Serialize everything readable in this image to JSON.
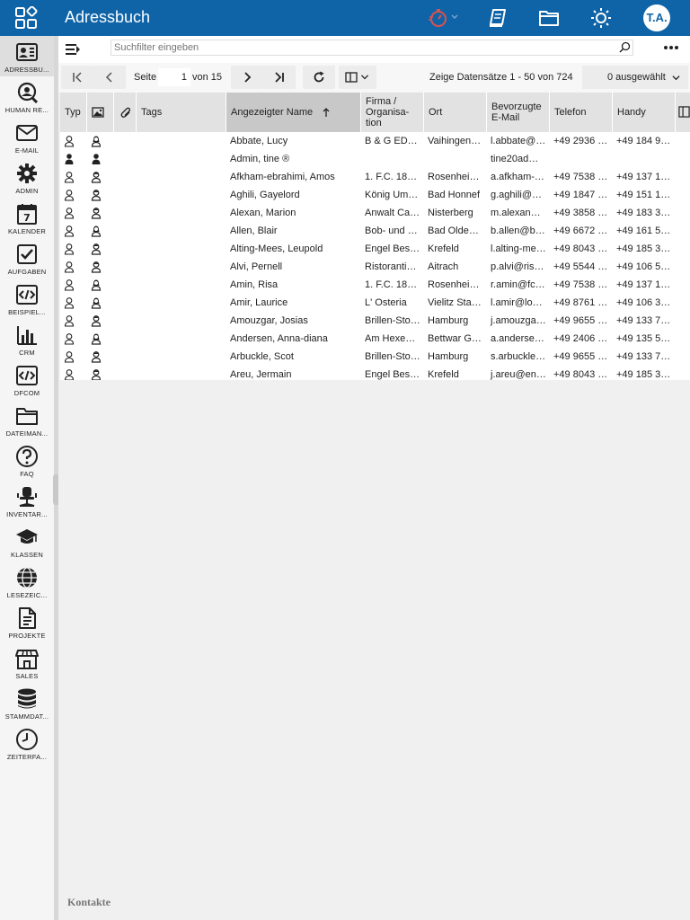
{
  "app": {
    "title": "Adressbuch",
    "user_initials": "T.A."
  },
  "colors": {
    "brand": "#0f64a8",
    "sidebar_bg": "#f5f5f5",
    "header_bg": "#e2e2e2",
    "timer_icon": "#d9534f"
  },
  "sidebar": {
    "items": [
      {
        "label": "ADRESSBU...",
        "icon": "contact-card-icon"
      },
      {
        "label": "HUMAN RE...",
        "icon": "user-search-icon"
      },
      {
        "label": "E-MAIL",
        "icon": "envelope-icon"
      },
      {
        "label": "ADMIN",
        "icon": "gear-icon"
      },
      {
        "label": "KALENDER",
        "icon": "calendar-icon"
      },
      {
        "label": "AUFGABEN",
        "icon": "checkbox-icon"
      },
      {
        "label": "BEISPIEL...",
        "icon": "code-icon"
      },
      {
        "label": "CRM",
        "icon": "bar-chart-icon"
      },
      {
        "label": "DFCOM",
        "icon": "code-icon"
      },
      {
        "label": "DATEIMAN...",
        "icon": "folder-icon"
      },
      {
        "label": "FAQ",
        "icon": "question-icon"
      },
      {
        "label": "INVENTAR...",
        "icon": "office-chair-icon"
      },
      {
        "label": "KLASSEN",
        "icon": "graduation-cap-icon"
      },
      {
        "label": "LESEZEIC...",
        "icon": "globe-icon"
      },
      {
        "label": "PROJEKTE",
        "icon": "document-icon"
      },
      {
        "label": "SALES",
        "icon": "store-icon"
      },
      {
        "label": "STAMMDAT...",
        "icon": "database-icon"
      },
      {
        "label": "ZEITERFA...",
        "icon": "clock-icon"
      }
    ]
  },
  "filter": {
    "placeholder": "Suchfilter eingeben"
  },
  "pager": {
    "page_label": "Seite",
    "current_page": "1",
    "of_label": "von 15",
    "records_text": "Zeige Datensätze 1 - 50 von 724",
    "selected_text": "0 ausgewählt"
  },
  "columns": [
    "Typ",
    "",
    "",
    "Tags",
    "Angezeigter Name",
    "Firma / Organisa-tion",
    "Ort",
    "Bevorzugte E-Mail",
    "Telefon",
    "Handy"
  ],
  "rows": [
    {
      "name": "Abbate, Lucy",
      "company": "B & G ED…",
      "city": "Vaihingen…",
      "email": "l.abbate@…",
      "phone": "+49 2936 …",
      "mobile": "+49 184 9…",
      "type": "outline",
      "gender": "female"
    },
    {
      "name": "Admin, tine ®",
      "company": "",
      "city": "",
      "email": "tine20ad…",
      "phone": "",
      "mobile": "",
      "type": "filled",
      "gender": "filled"
    },
    {
      "name": "Afkham-ebrahimi, Amos",
      "company": "1. F.C. 18…",
      "city": "Rosenhei…",
      "email": "a.afkham-…",
      "phone": "+49 7538 …",
      "mobile": "+49 137 1…",
      "type": "outline",
      "gender": "male"
    },
    {
      "name": "Aghili, Gayelord",
      "company": "König Um…",
      "city": "Bad Honnef",
      "email": "g.aghili@…",
      "phone": "+49 1847 …",
      "mobile": "+49 151 1…",
      "type": "outline",
      "gender": "male"
    },
    {
      "name": "Alexan, Marion",
      "company": "Anwalt Ca…",
      "city": "Nisterberg",
      "email": "m.alexan…",
      "phone": "+49 3858 …",
      "mobile": "+49 183 3…",
      "type": "outline",
      "gender": "male"
    },
    {
      "name": "Allen, Blair",
      "company": "Bob- und …",
      "city": "Bad Olde…",
      "email": "b.allen@b…",
      "phone": "+49 6672 …",
      "mobile": "+49 161 5…",
      "type": "outline",
      "gender": "female"
    },
    {
      "name": "Alting-Mees, Leupold",
      "company": "Engel Bes…",
      "city": "Krefeld",
      "email": "l.alting-me…",
      "phone": "+49 8043 …",
      "mobile": "+49 185 3…",
      "type": "outline",
      "gender": "male"
    },
    {
      "name": "Alvi, Pernell",
      "company": "Ristoranti…",
      "city": "Aitrach",
      "email": "p.alvi@ris…",
      "phone": "+49 5544 …",
      "mobile": "+49 106 5…",
      "type": "outline",
      "gender": "male"
    },
    {
      "name": "Amin, Risa",
      "company": "1. F.C. 18…",
      "city": "Rosenhei…",
      "email": "r.amin@fc…",
      "phone": "+49 7538 …",
      "mobile": "+49 137 1…",
      "type": "outline",
      "gender": "female"
    },
    {
      "name": "Amir, Laurice",
      "company": "L' Osteria",
      "city": "Vielitz Sta…",
      "email": "l.amir@lo…",
      "phone": "+49 8761 …",
      "mobile": "+49 106 3…",
      "type": "outline",
      "gender": "female"
    },
    {
      "name": "Amouzgar, Josias",
      "company": "Brillen-Sto…",
      "city": "Hamburg",
      "email": "j.amouzga…",
      "phone": "+49 9655 …",
      "mobile": "+49 133 7…",
      "type": "outline",
      "gender": "male"
    },
    {
      "name": "Andersen, Anna-diana",
      "company": "Am Hexe…",
      "city": "Bettwar G…",
      "email": "a.anderse…",
      "phone": "+49 2406 …",
      "mobile": "+49 135 5…",
      "type": "outline",
      "gender": "female"
    },
    {
      "name": "Arbuckle, Scot",
      "company": "Brillen-Sto…",
      "city": "Hamburg",
      "email": "s.arbuckle…",
      "phone": "+49 9655 …",
      "mobile": "+49 133 7…",
      "type": "outline",
      "gender": "male"
    },
    {
      "name": "Areu, Jermain",
      "company": "Engel Bes…",
      "city": "Krefeld",
      "email": "j.areu@en…",
      "phone": "+49 8043 …",
      "mobile": "+49 185 3…",
      "type": "outline",
      "gender": "male"
    }
  ],
  "footer": {
    "label": "Kontakte"
  }
}
